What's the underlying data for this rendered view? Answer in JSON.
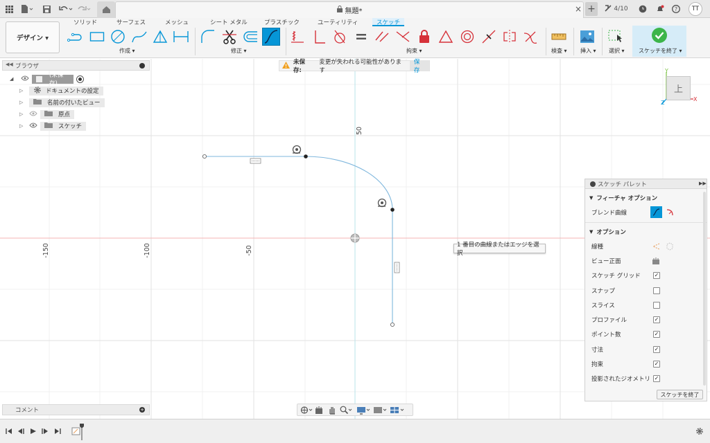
{
  "titlebar": {
    "doc_title": "無題*",
    "jobs": "4/10",
    "user_initials": "TT"
  },
  "ribbon": {
    "tabs": [
      "ソリッド",
      "サーフェス",
      "メッシュ",
      "シート メタル",
      "プラスチック",
      "ユーティリティ",
      "スケッチ"
    ],
    "active_tab": "スケッチ",
    "design_label": "デザイン ▾",
    "groups": {
      "create": "作成 ▾",
      "modify": "修正 ▾",
      "constraints": "拘束 ▾",
      "inspect": "検査 ▾",
      "insert": "挿入 ▾",
      "select": "選択 ▾",
      "finish": "スケッチを終了 ▾"
    }
  },
  "browser": {
    "title": "ブラウザ",
    "items": [
      {
        "label": "(未保存)"
      },
      {
        "label": "ドキュメントの設定"
      },
      {
        "label": "名前の付いたビュー"
      },
      {
        "label": "原点"
      },
      {
        "label": "スケッチ"
      }
    ]
  },
  "warning": {
    "prefix": "未保存:",
    "message": "変更が失われる可能性があります",
    "save": "保存"
  },
  "viewcube": {
    "face": "上",
    "x": "X",
    "y": "Y",
    "z": "Z"
  },
  "axis_labels": {
    "h": [
      "-150",
      "-100",
      "-50"
    ],
    "v": "50"
  },
  "tooltip": "1 番目の曲線またはエッジを選択",
  "palette": {
    "title": "スケッチ パレット",
    "feature_options": "フィーチャ オプション",
    "blend_curve": "ブレンド曲線",
    "options": "オプション",
    "rows": [
      {
        "label": "線種",
        "type": "icon"
      },
      {
        "label": "ビュー正面",
        "type": "icon"
      },
      {
        "label": "スケッチ グリッド",
        "checked": true
      },
      {
        "label": "スナップ",
        "checked": false
      },
      {
        "label": "スライス",
        "checked": false
      },
      {
        "label": "プロファイル",
        "checked": true
      },
      {
        "label": "ポイント数",
        "checked": true
      },
      {
        "label": "寸法",
        "checked": true
      },
      {
        "label": "拘束",
        "checked": true
      },
      {
        "label": "投影されたジオメトリ",
        "checked": true
      }
    ],
    "finish_button": "スケッチを終了"
  },
  "comments": "コメント",
  "colors": {
    "accent": "#0696d7",
    "constraint_red": "#d6323a",
    "finish_green": "#3cb54a"
  }
}
